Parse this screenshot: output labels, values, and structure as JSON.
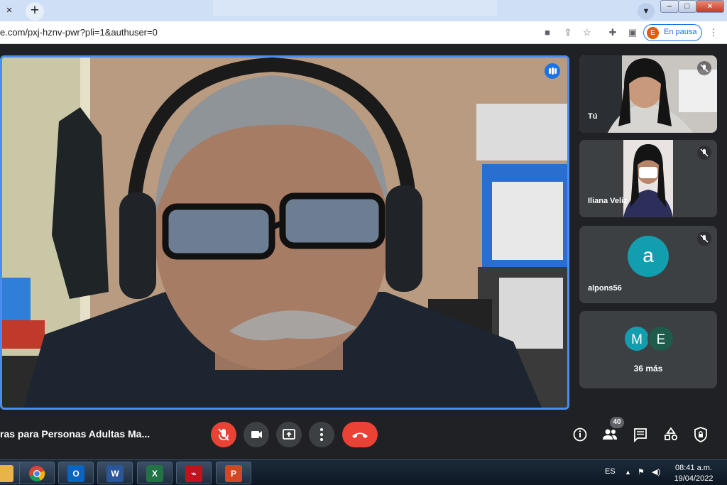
{
  "browser": {
    "tab_close": "×",
    "new_tab": "+",
    "url": "e.com/pxj-hznv-pwr?pli=1&authuser=0",
    "profile_initial": "E",
    "profile_status": "En pausa",
    "window_controls": {
      "minimize": "–",
      "maximize": "□",
      "close": "×"
    }
  },
  "sidebar_tiles": [
    {
      "name": "Tú",
      "muted": true,
      "type": "video"
    },
    {
      "name": "Iliana Veliz",
      "muted": true,
      "type": "video"
    },
    {
      "name": "alpons56",
      "muted": true,
      "type": "avatar",
      "initial": "a"
    },
    {
      "type": "overflow",
      "initials": [
        "M",
        "E"
      ],
      "more_label": "36 más"
    }
  ],
  "bottom_bar": {
    "meeting_title": "ras para Personas Adultas Ma...",
    "participant_count": "40"
  },
  "taskbar": {
    "apps": [
      "file-explorer",
      "chrome",
      "outlook",
      "word",
      "excel",
      "acrobat",
      "powerpoint"
    ],
    "app_letters": {
      "outlook": "O",
      "word": "W",
      "excel": "X",
      "powerpoint": "P"
    },
    "language": "ES",
    "time": "08:41 a.m.",
    "date": "19/04/2022"
  },
  "colors": {
    "accent_blue": "#1a73e8",
    "hangup_red": "#ea4335",
    "tile_bg": "#3c4043",
    "avatar_teal": "#129eaf",
    "avatar_green": "#1e5b4a"
  }
}
